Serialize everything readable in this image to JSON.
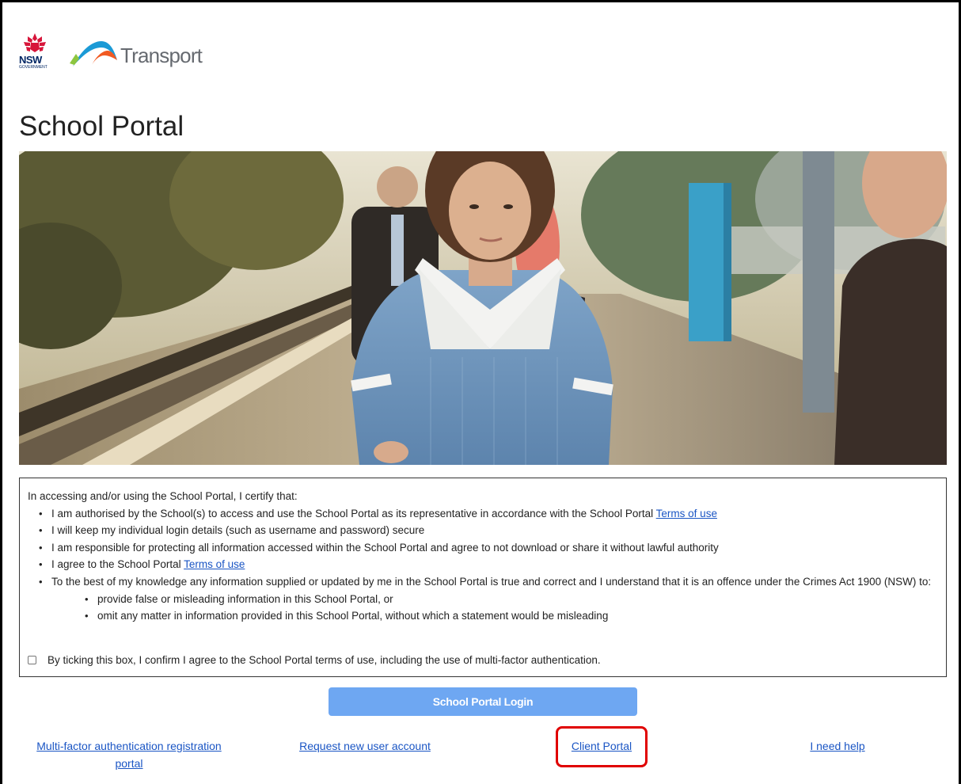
{
  "header": {
    "nsw_logo_text": "NSW",
    "nsw_logo_subtext": "GOVERNMENT",
    "transport_logo_text": "Transport"
  },
  "page_title": "School Portal",
  "hero_image": {
    "icon": "hero-photo"
  },
  "terms": {
    "intro": "In accessing and/or using the School Portal, I certify that:",
    "items": [
      {
        "text": "I am authorised by the School(s) to access and use the School Portal as its representative in accordance with the School Portal ",
        "link": "Terms of use"
      },
      {
        "text": "I will keep my individual login details (such as username and password) secure"
      },
      {
        "text": "I am responsible for protecting all information accessed within the School Portal and agree to not download or share it without lawful authority"
      },
      {
        "text": "I agree to the School Portal ",
        "link": "Terms of use"
      },
      {
        "text": "To the best of my knowledge any information supplied or updated by me in the School Portal is true and correct and I understand that it is an offence under the Crimes Act 1900 (NSW) to:"
      }
    ],
    "sub_items": [
      "provide false or misleading information in this School Portal, or",
      "omit any matter in information provided in this School Portal, without which a statement would be misleading"
    ],
    "agree_label": "By ticking this box, I confirm I agree to the School Portal terms of use, including the use of multi-factor authentication.",
    "agree_checked": false
  },
  "login_button": "School Portal Login",
  "footer": {
    "mfa_link": "Multi-factor authentication registration portal",
    "request_link": "Request new user account",
    "client_link": "Client Portal",
    "help_link": "I need help"
  },
  "colors": {
    "accent_button": "#6ea7f2",
    "link": "#1a55c4",
    "highlight": "#e00000",
    "nsw_red": "#d7153a",
    "nsw_navy": "#002664"
  }
}
